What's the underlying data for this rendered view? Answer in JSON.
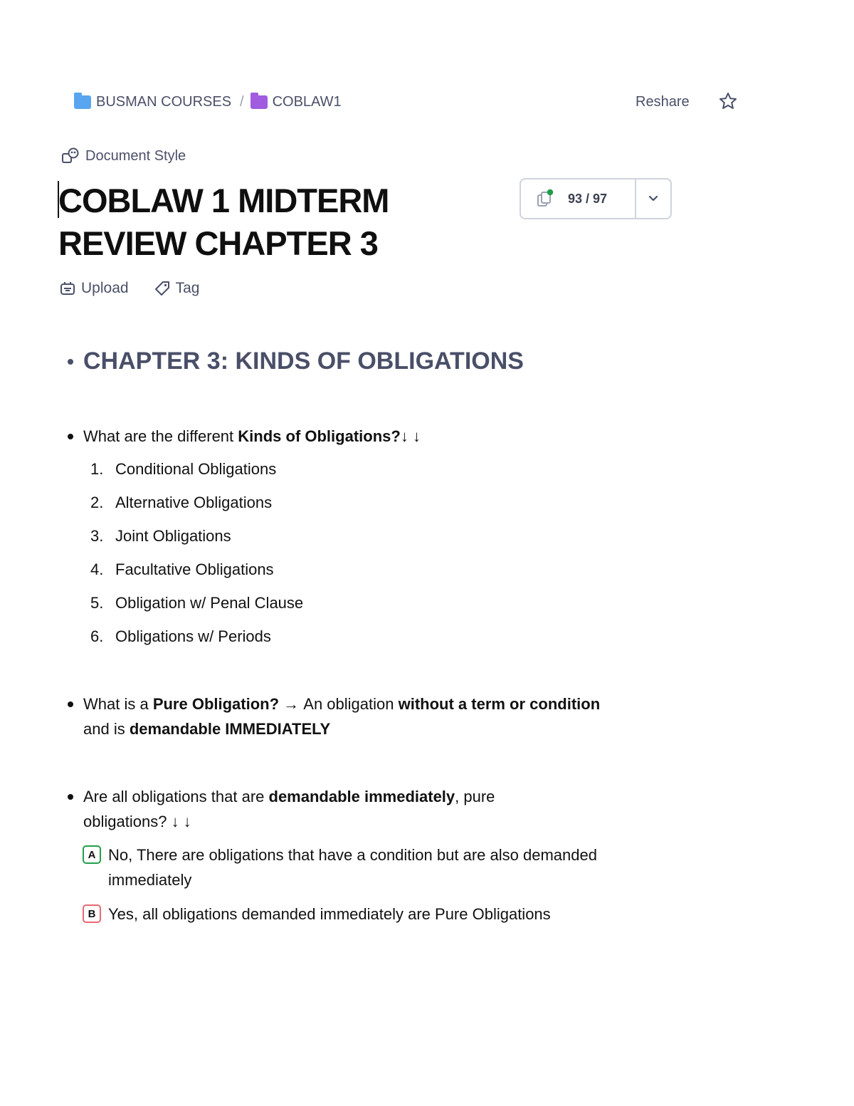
{
  "breadcrumb": {
    "folder1": "BUSMAN COURSES",
    "separator": "/",
    "folder2": "COBLAW1"
  },
  "header": {
    "reshare": "Reshare"
  },
  "doc_style": "Document Style",
  "title_lines": [
    "COBLAW 1 MIDTERM",
    "REVIEW CHAPTER 3"
  ],
  "progress": {
    "count": "93 / 97"
  },
  "actions": {
    "upload": "Upload",
    "tag": "Tag"
  },
  "section_heading": "CHAPTER 3: KINDS OF OBLIGATIONS",
  "q1": {
    "pre": "What are the different ",
    "bold": "Kinds of Obligations?",
    "arrows": "↓  ↓"
  },
  "kinds": [
    {
      "num": "1.",
      "label": "Conditional Obligations"
    },
    {
      "num": "2.",
      "label": "Alternative Obligations"
    },
    {
      "num": "3.",
      "label": "Joint Obligations"
    },
    {
      "num": "4.",
      "label": "Facultative Obligations"
    },
    {
      "num": "5.",
      "label": "Obligation w/ Penal Clause"
    },
    {
      "num": "6.",
      "label": "Obligations w/ Periods"
    }
  ],
  "q2": {
    "pre": "What is a ",
    "bold1": "Pure Obligation?",
    "arrow": " → ",
    "mid": "An obligation ",
    "bold2": "without a term or condition",
    "mid2": " and is ",
    "bold3": "demandable IMMEDIATELY"
  },
  "q3": {
    "pre": "Are all obligations that are ",
    "bold": "demandable immediately",
    "post": ", pure obligations?",
    "arrows": "↓  ↓"
  },
  "answers": [
    {
      "letter": "A",
      "text": "No, There are obligations that have a condition but are also demanded immediately"
    },
    {
      "letter": "B",
      "text": "Yes, all obligations demanded immediately are Pure Obligations"
    }
  ]
}
